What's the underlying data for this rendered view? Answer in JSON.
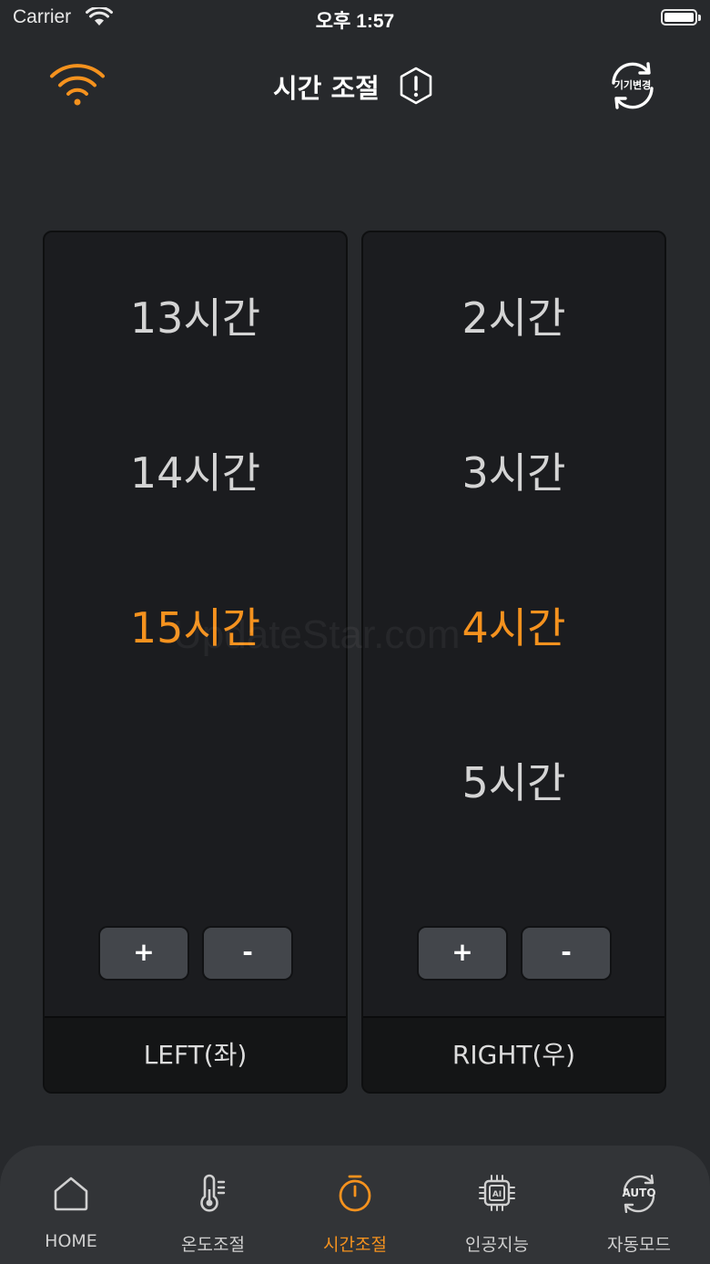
{
  "status_bar": {
    "carrier": "Carrier",
    "time": "오후 1:57"
  },
  "header": {
    "title": "시간 조절",
    "change_device_label": "기기변경",
    "accent_color": "#f5921e"
  },
  "left_panel": {
    "hours": [
      "13시간",
      "14시간",
      "15시간",
      ""
    ],
    "selected_index": 2,
    "plus_label": "+",
    "minus_label": "-",
    "side_label": "LEFT(좌)"
  },
  "right_panel": {
    "hours": [
      "2시간",
      "3시간",
      "4시간",
      "5시간"
    ],
    "selected_index": 2,
    "plus_label": "+",
    "minus_label": "-",
    "side_label": "RIGHT(우)"
  },
  "watermark": "UpdateStar.com",
  "tabbar": {
    "active_index": 2,
    "tabs": [
      {
        "label": "HOME",
        "icon": "home-icon"
      },
      {
        "label": "온도조절",
        "icon": "thermometer-icon"
      },
      {
        "label": "시간조절",
        "icon": "timer-icon"
      },
      {
        "label": "인공지능",
        "icon": "ai-chip-icon"
      },
      {
        "label": "자동모드",
        "icon": "auto-mode-icon",
        "icon_text": "AUTO"
      }
    ]
  }
}
